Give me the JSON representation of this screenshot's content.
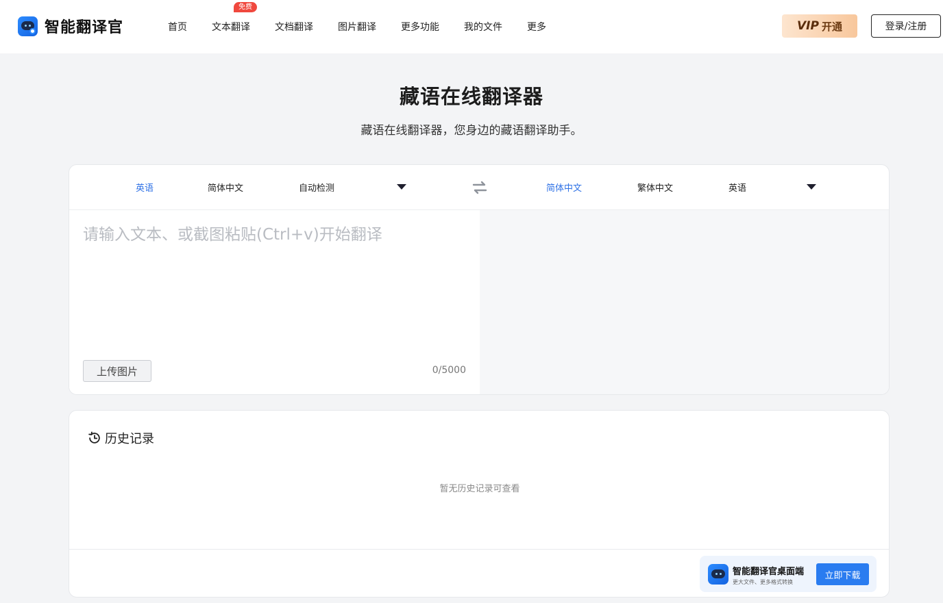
{
  "header": {
    "logo_text": "智能翻译官",
    "nav": [
      {
        "label": "首页"
      },
      {
        "label": "文本翻译",
        "badge": "免费"
      },
      {
        "label": "文档翻译"
      },
      {
        "label": "图片翻译"
      },
      {
        "label": "更多功能"
      },
      {
        "label": "我的文件"
      },
      {
        "label": "更多"
      }
    ],
    "vip_word": "VIP",
    "vip_label": "开通",
    "login_label": "登录/注册"
  },
  "hero": {
    "title": "藏语在线翻译器",
    "subtitle": "藏语在线翻译器，您身边的藏语翻译助手。"
  },
  "translator": {
    "source_langs": [
      "英语",
      "简体中文",
      "自动检测"
    ],
    "target_langs": [
      "简体中文",
      "繁体中文",
      "英语"
    ],
    "active_source": "英语",
    "active_target": "简体中文",
    "input_value": "",
    "input_placeholder": "请输入文本、或截图粘贴(Ctrl+v)开始翻译",
    "upload_label": "上传图片",
    "char_count": "0/5000",
    "colors": {
      "active_lang": "#2f72e6",
      "target_bg": "#f6f7f9"
    }
  },
  "history": {
    "title": "历史记录",
    "empty_text": "暂无历史记录可查看"
  },
  "promo": {
    "title": "智能翻译官桌面端",
    "subtitle": "更大文件、更多格式转换",
    "button_label": "立即下载",
    "colors": {
      "button": "#2a7cf0",
      "background": "#eef4fd"
    }
  },
  "icons": {
    "logo": "robot-logo-icon",
    "swap": "swap-arrows-icon",
    "caret": "caret-down-icon",
    "history": "history-clock-icon"
  }
}
